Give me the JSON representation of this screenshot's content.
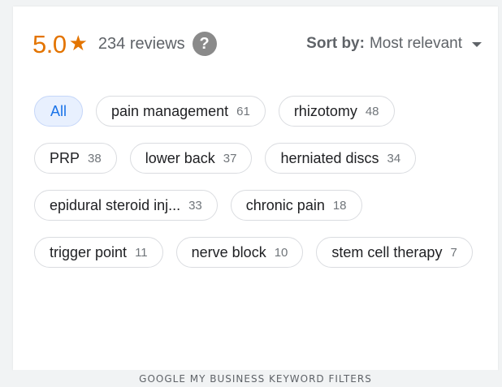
{
  "rating": {
    "value": "5.0",
    "star": "★",
    "reviews": "234 reviews",
    "help_icon": "?"
  },
  "sort": {
    "label": "Sort by:",
    "value": "Most relevant",
    "icon": "caret-down-icon"
  },
  "chips": [
    {
      "label": "All",
      "count": "",
      "selected": true
    },
    {
      "label": "pain management",
      "count": "61"
    },
    {
      "label": "rhizotomy",
      "count": "48"
    },
    {
      "label": "PRP",
      "count": "38"
    },
    {
      "label": "lower back",
      "count": "37"
    },
    {
      "label": "herniated discs",
      "count": "34"
    },
    {
      "label": "epidural steroid inj...",
      "count": "33"
    },
    {
      "label": "chronic pain",
      "count": "18"
    },
    {
      "label": "trigger point",
      "count": "11"
    },
    {
      "label": "nerve block",
      "count": "10"
    },
    {
      "label": "stem cell therapy",
      "count": "7"
    }
  ],
  "caption": "GOOGLE MY BUSINESS KEYWORD FILTERS",
  "colors": {
    "rating": "#e37400",
    "selected_chip_bg": "#e8f0fe",
    "selected_chip_text": "#1a73e8"
  }
}
